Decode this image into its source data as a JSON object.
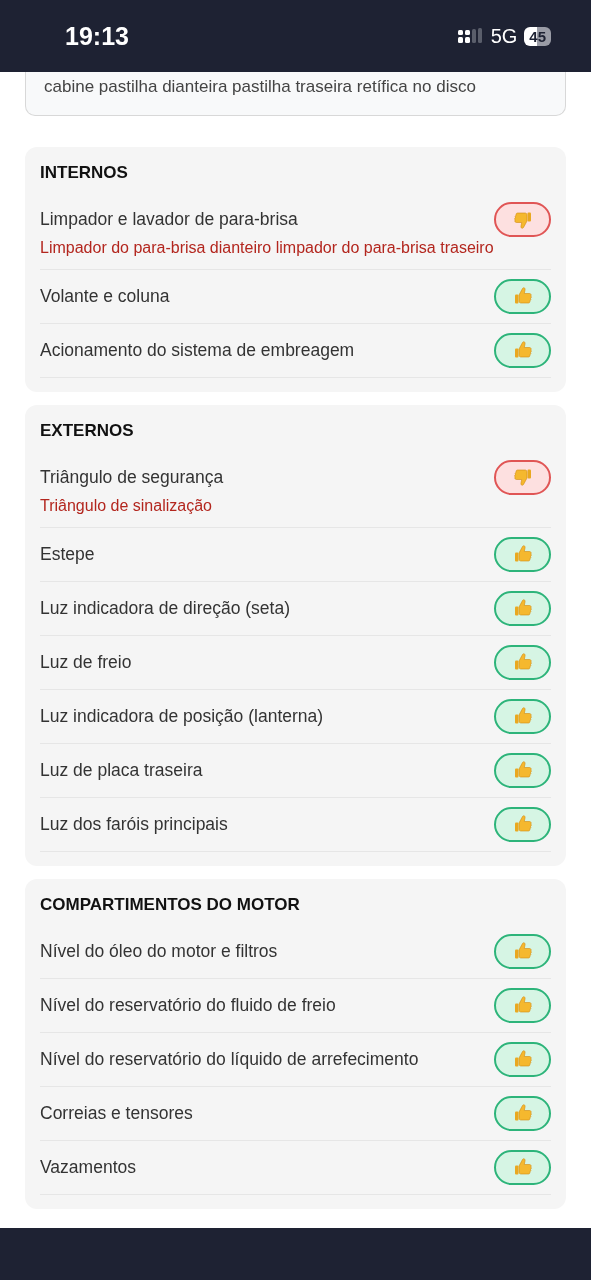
{
  "status_bar": {
    "time": "19:13",
    "network": "5G",
    "battery": "45"
  },
  "notes_card": {
    "text": "cabine pastilha dianteira pastilha traseira retífica no disco"
  },
  "sections": [
    {
      "title": "INTERNOS",
      "items": [
        {
          "label": "Limpador e lavador de para-brisa",
          "approved": false,
          "note": "Limpador do para-brisa dianteiro limpador do para-brisa traseiro"
        },
        {
          "label": "Volante e coluna",
          "approved": true
        },
        {
          "label": "Acionamento do sistema de embreagem",
          "approved": true
        }
      ]
    },
    {
      "title": "EXTERNOS",
      "items": [
        {
          "label": "Triângulo de segurança",
          "approved": false,
          "note": "Triângulo de sinalização"
        },
        {
          "label": "Estepe",
          "approved": true
        },
        {
          "label": "Luz indicadora de direção (seta)",
          "approved": true
        },
        {
          "label": "Luz de freio",
          "approved": true
        },
        {
          "label": "Luz indicadora de posição (lanterna)",
          "approved": true
        },
        {
          "label": "Luz de placa traseira",
          "approved": true
        },
        {
          "label": "Luz dos faróis principais",
          "approved": true
        }
      ]
    },
    {
      "title": "COMPARTIMENTOS DO MOTOR",
      "items": [
        {
          "label": "Nível do óleo do motor e filtros",
          "approved": true
        },
        {
          "label": "Nível do reservatório do fluido de freio",
          "approved": true
        },
        {
          "label": "Nível do reservatório do líquido de arrefecimento",
          "approved": true
        },
        {
          "label": "Correias e tensores",
          "approved": true
        },
        {
          "label": "Vazamentos",
          "approved": true
        }
      ]
    }
  ]
}
